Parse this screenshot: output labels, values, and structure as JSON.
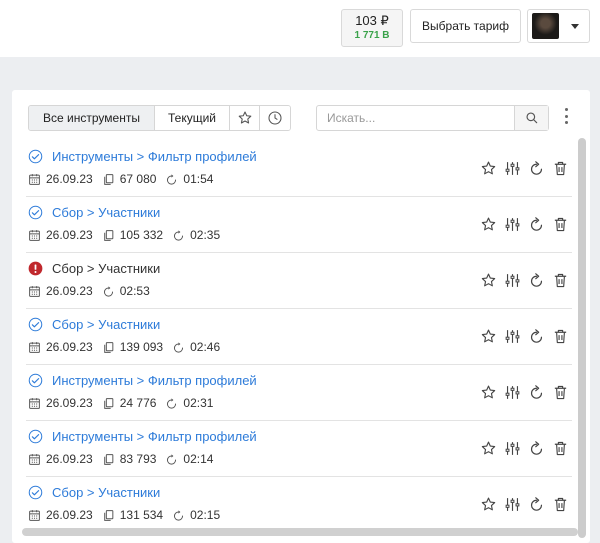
{
  "header": {
    "balance": "103 ₽",
    "bonus": "1 771 B",
    "tariff_button": "Выбрать тариф"
  },
  "toolbar": {
    "tabs": [
      "Все инструменты",
      "Текущий"
    ],
    "search_placeholder": "Искать..."
  },
  "colors": {
    "link": "#2d7bd9",
    "success": "#2d7bd9",
    "error": "#c0282d",
    "bonus": "#3aa24a"
  },
  "tasks": [
    {
      "status": "success",
      "title": "Инструменты > Фильтр профилей",
      "date": "26.09.23",
      "count": "67 080",
      "duration": "01:54"
    },
    {
      "status": "success",
      "title": "Сбор > Участники",
      "date": "26.09.23",
      "count": "105 332",
      "duration": "02:35"
    },
    {
      "status": "error",
      "title": "Сбор > Участники",
      "date": "26.09.23",
      "duration": "02:53"
    },
    {
      "status": "success",
      "title": "Сбор > Участники",
      "date": "26.09.23",
      "count": "139 093",
      "duration": "02:46"
    },
    {
      "status": "success",
      "title": "Инструменты > Фильтр профилей",
      "date": "26.09.23",
      "count": "24 776",
      "duration": "02:31"
    },
    {
      "status": "success",
      "title": "Инструменты > Фильтр профилей",
      "date": "26.09.23",
      "count": "83 793",
      "duration": "02:14"
    },
    {
      "status": "success",
      "title": "Сбор > Участники",
      "date": "26.09.23",
      "count": "131 534",
      "duration": "02:15"
    }
  ]
}
